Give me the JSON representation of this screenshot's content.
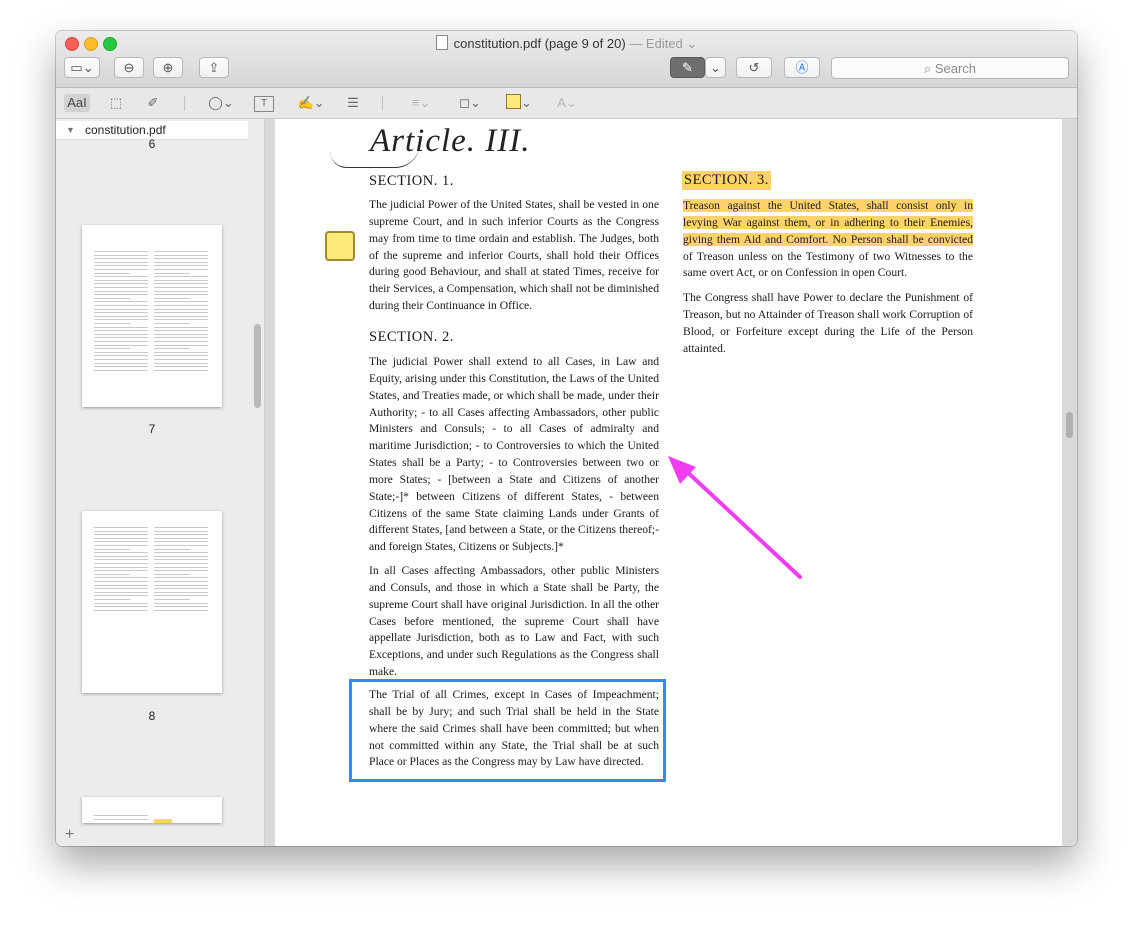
{
  "window": {
    "title": "constitution.pdf (page 9 of 20)",
    "edited_label": "— Edited",
    "edited_chevron": "⌄"
  },
  "toolbar": {
    "sidebar_toggle_icon": "▭⌄",
    "zoom_out_icon": "⊖",
    "zoom_in_icon": "⊕",
    "share_icon": "⇪",
    "markup_pen_icon": "✎",
    "markup_chevron": "⌄",
    "rotate_icon": "↺",
    "annotate_icon": "Ⓐ",
    "search_placeholder": "Search",
    "search_icon": "⌕"
  },
  "markup_bar": {
    "text_style": "AaI",
    "rect_select": "⬚",
    "sketch": "✐",
    "shapes": "◯⌄",
    "text_box": "T",
    "sign": "✍⌄",
    "note": "☰",
    "line_style": "≡⌄",
    "border_color": "◻⌄",
    "fill_color_chevron": "⌄",
    "text_format": "A⌄",
    "fill_color": "#ffe97a"
  },
  "sidebar": {
    "file_name": "constitution.pdf",
    "expand_icon": "▼",
    "page_numbers": [
      "6",
      "7",
      "8"
    ],
    "add_icon": "+"
  },
  "document": {
    "article_title": "Article. III.",
    "section1": {
      "heading": "SECTION. 1.",
      "text": "The judicial Power of the United States, shall be vested in one supreme Court, and in such inferior Courts as the Congress may from time to time ordain and establish. The Judges, both of the supreme and inferior Courts, shall hold their Offices during good Behaviour, and shall at stated Times, receive for their Services, a Compensation, which shall not be diminished during their Continuance in Office."
    },
    "section2": {
      "heading": "SECTION. 2.",
      "para1": "The judicial Power shall extend to all Cases, in Law and Equity, arising under this Constitution, the Laws of the United States, and Treaties made, or which shall be made, under their Authority; - to all Cases affecting Ambassadors, other public Ministers and Consuls; - to all Cases of admiralty and maritime Jurisdiction; - to Controversies to which the United States shall be a Party; - to Controversies between two or more States; - [between a State and Citizens of another State;-]* between Citizens of different States, - between Citizens of the same State claiming Lands under Grants of different States, [and between a State, or the Citizens thereof;- and foreign States, Citizens or Subjects.]*",
      "para2": "In all Cases affecting Ambassadors, other public Ministers and Consuls, and those in which a State shall be Party, the supreme Court shall have original Jurisdiction. In all the other Cases before mentioned, the supreme Court shall have appellate Jurisdiction, both as to Law and Fact, with such Exceptions, and under such Regulations as the Congress shall make.",
      "para3": "The Trial of all Crimes, except in Cases of Impeachment; shall be by Jury; and such Trial shall be held in the State where the said Crimes shall have been committed; but when not committed within any State, the Trial shall be at such Place or Places as the Congress may by Law have directed."
    },
    "section3": {
      "heading": "SECTION. 3.",
      "highlighted_text": "Treason against the United States, shall consist only in levying War against them, or in adhering to their Enemies, giving them Aid and Comfort. No Person shall be convicted",
      "rest_text": " of Treason unless on the Testimony of two Witnesses to the same overt Act, or on Confession in open Court.",
      "para2": "The Congress shall have Power to declare the Punishment of Treason, but no Attainder of Treason shall work Corruption of Blood, or Forfeiture except during the Life of the Person attainted."
    }
  },
  "annotations": {
    "note_color": "#ffe97a",
    "highlight_color": "#ffd36a",
    "box_color": "#3b87ea",
    "arrow_color": "#f13df1"
  }
}
